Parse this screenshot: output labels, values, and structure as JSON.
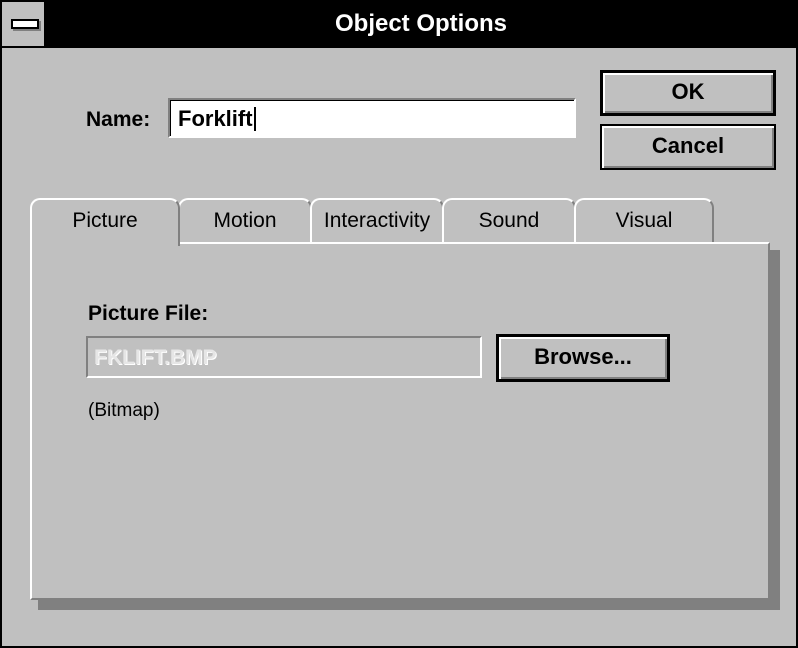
{
  "window": {
    "title": "Object Options"
  },
  "name_field": {
    "label": "Name:",
    "value": "Forklift"
  },
  "buttons": {
    "ok": "OK",
    "cancel": "Cancel",
    "browse": "Browse..."
  },
  "tabs": [
    {
      "label": "Picture",
      "active": true
    },
    {
      "label": "Motion",
      "active": false
    },
    {
      "label": "Interactivity",
      "active": false
    },
    {
      "label": "Sound",
      "active": false
    },
    {
      "label": "Visual",
      "active": false
    }
  ],
  "picture_tab": {
    "file_label": "Picture File:",
    "file_value": "FKLIFT.BMP",
    "file_type": "(Bitmap)"
  },
  "icons": {
    "system_menu": "system-menu-icon"
  },
  "colors": {
    "title_bar": "#000000",
    "face": "#c0c0c0",
    "disabled_text": "#e6e6e6"
  }
}
